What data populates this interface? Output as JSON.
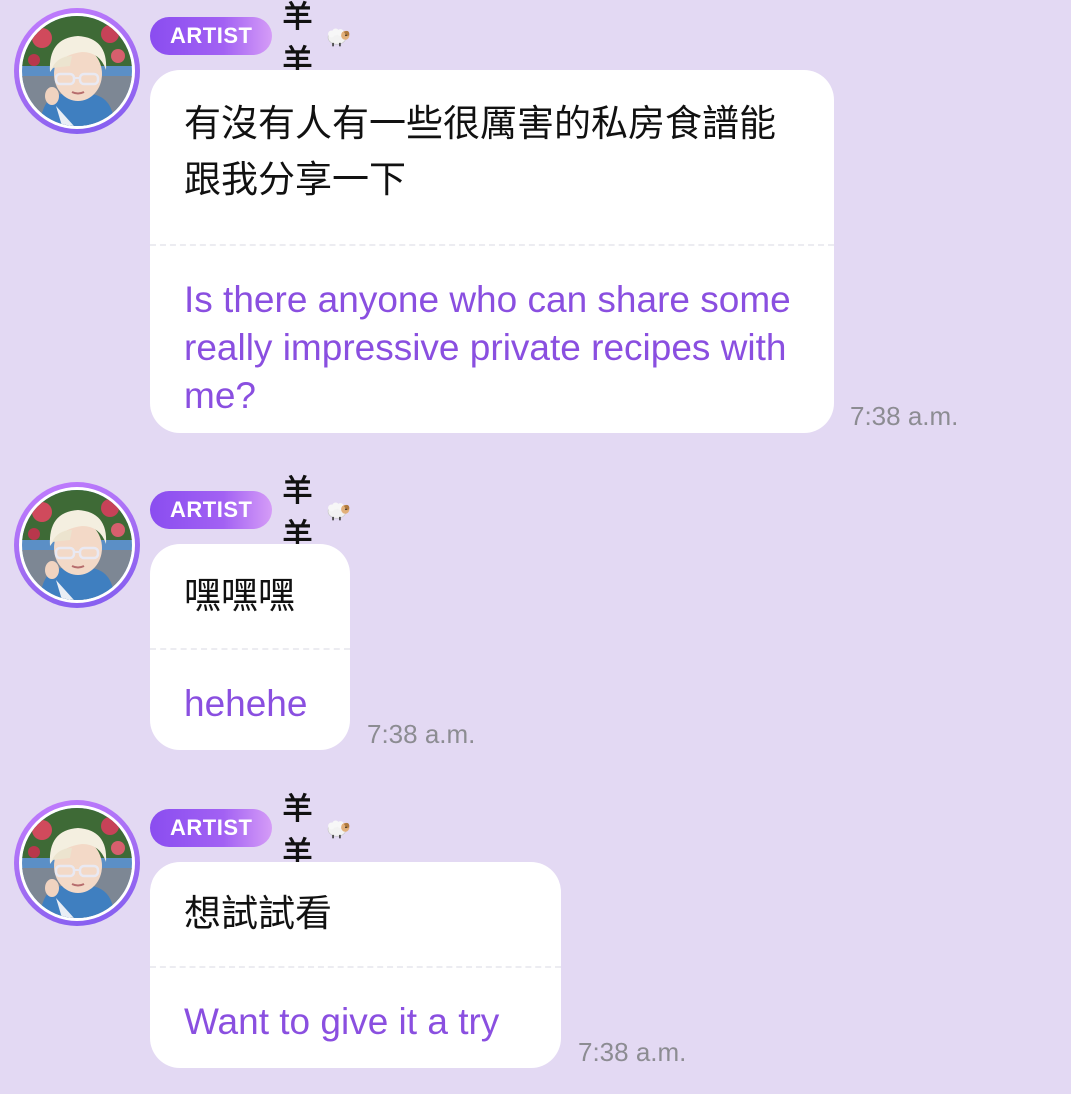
{
  "messages": [
    {
      "badge": "ARTIST",
      "name": "羊羊",
      "name_emoji": "sheep-icon",
      "original": "有沒有人有一些很厲害的私房食譜能跟我分享一下",
      "translation": "Is there anyone who can share some really impressive private recipes with me?",
      "time": "7:38 a.m."
    },
    {
      "badge": "ARTIST",
      "name": "羊羊",
      "name_emoji": "sheep-icon",
      "original": "嘿嘿嘿",
      "translation": "hehehe",
      "time": "7:38 a.m."
    },
    {
      "badge": "ARTIST",
      "name": "羊羊",
      "name_emoji": "sheep-icon",
      "original": "想試試看",
      "translation": "Want to give it a try",
      "time": "7:38 a.m."
    }
  ],
  "colors": {
    "background": "#e3d9f3",
    "badge_gradient_start": "#8a4df0",
    "badge_gradient_end": "#d59cf7",
    "translation_text": "#8a4fe0",
    "timestamp": "#8c8c92"
  }
}
